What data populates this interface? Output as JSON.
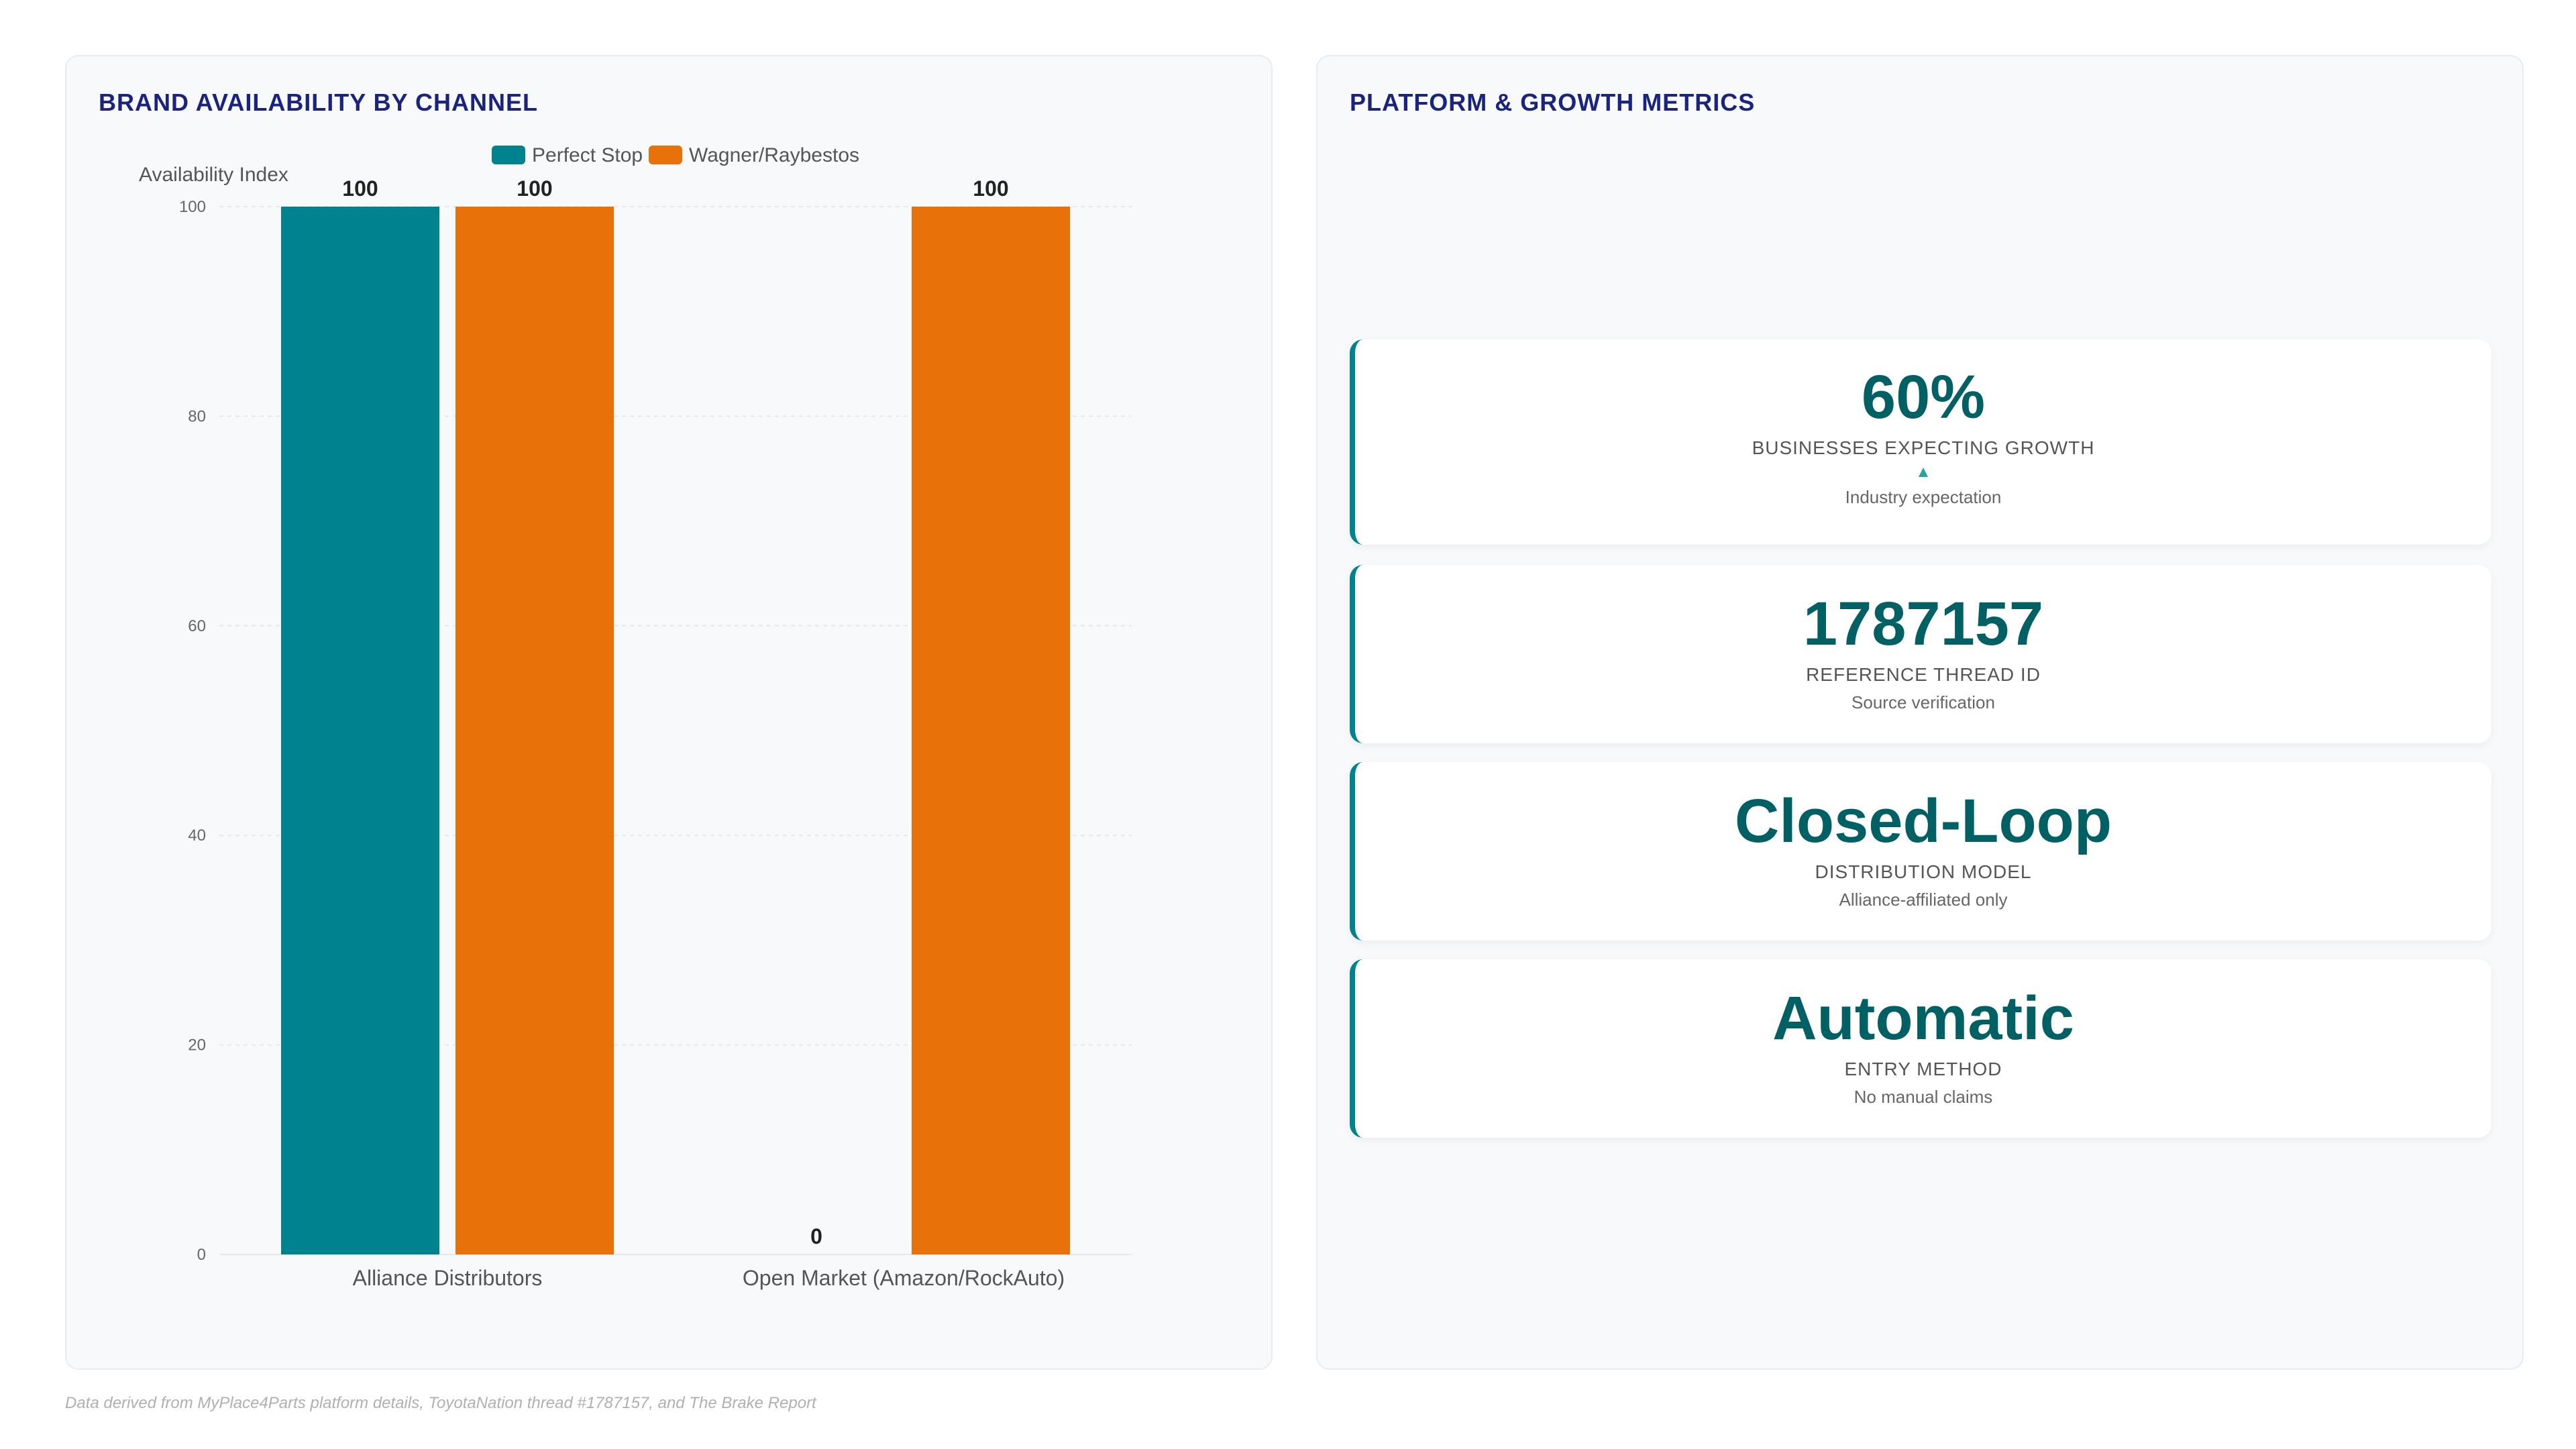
{
  "left_panel": {
    "title": "BRAND AVAILABILITY BY CHANNEL"
  },
  "right_panel": {
    "title": "PLATFORM & GROWTH METRICS"
  },
  "chart_data": {
    "type": "bar",
    "categories": [
      "Alliance Distributors",
      "Open Market (Amazon/RockAuto)"
    ],
    "series": [
      {
        "name": "Perfect Stop",
        "values": [
          100,
          0
        ],
        "color": "#00838f"
      },
      {
        "name": "Wagner/Raybestos",
        "values": [
          100,
          100
        ],
        "color": "#e8710a"
      }
    ],
    "ylabel": "Availability Index",
    "ylim": [
      0,
      100
    ],
    "yticks": [
      0,
      20,
      40,
      60,
      80,
      100
    ],
    "data_labels": true,
    "grid": true,
    "legend_position": "top"
  },
  "metrics": [
    {
      "value": "60%",
      "label": "BUSINESSES EXPECTING GROWTH",
      "arrow": "▲",
      "note": "Industry expectation"
    },
    {
      "value": "1787157",
      "label": "REFERENCE THREAD ID",
      "note": "Source verification"
    },
    {
      "value": "Closed-Loop",
      "label": "DISTRIBUTION MODEL",
      "note": "Alliance-affiliated only"
    },
    {
      "value": "Automatic",
      "label": "ENTRY METHOD",
      "note": "No manual claims"
    }
  ],
  "footnote": "Data derived from MyPlace4Parts platform details, ToyotaNation thread #1787157, and The Brake Report"
}
